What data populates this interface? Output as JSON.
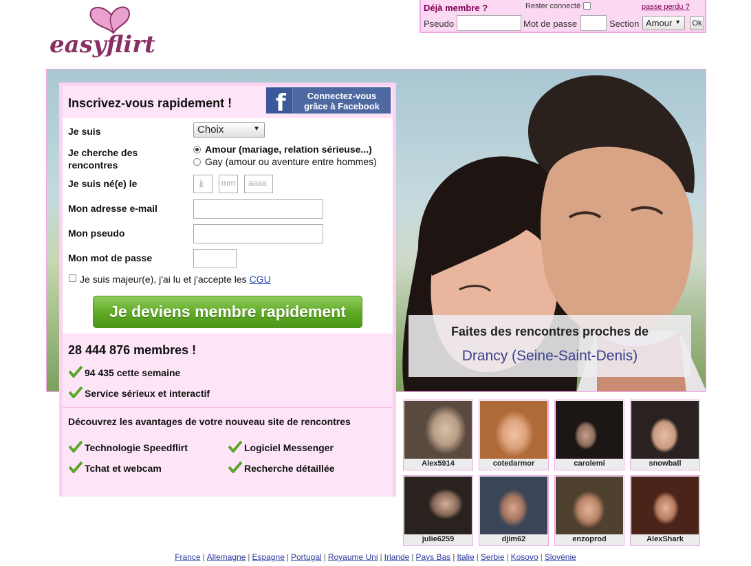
{
  "brand": {
    "logo_text": "easyflirt"
  },
  "login": {
    "title": "Déjà membre ?",
    "remember_label": "Rester connecté",
    "lost_password": "passe perdu ?",
    "pseudo_label": "Pseudo",
    "password_label": "Mot de passe",
    "section_label": "Section",
    "section_value": "Amour",
    "ok_label": "Ok"
  },
  "signup": {
    "title": "Inscrivez-vous rapidement !",
    "facebook_line1": "Connectez-vous",
    "facebook_line2": "grâce à Facebook",
    "gender_label": "Je suis",
    "gender_value": "Choix",
    "looking_label": "Je cherche des rencontres",
    "option_love": "Amour (mariage, relation sérieuse...)",
    "option_gay": "Gay (amour ou aventure entre hommes)",
    "birth_label": "Je suis né(e) le",
    "day_placeholder": "jj",
    "month_placeholder": "mm",
    "year_placeholder": "aaaa",
    "email_label": "Mon adresse e-mail",
    "pseudo_label": "Mon pseudo",
    "password_label": "Mon mot de passe",
    "agree_text": "Je suis majeur(e), j'ai lu et j'accepte les",
    "agree_link": "CGU",
    "submit_label": "Je deviens membre rapidement"
  },
  "stats": {
    "members": "28 444 876 membres !",
    "this_week": "94 435 cette semaine",
    "service": "Service sérieux et interactif",
    "advantages_title": "Découvrez les avantages de votre nouveau site de rencontres",
    "advantages": [
      "Technologie Speedflirt",
      "Logiciel Messenger",
      "Tchat et webcam",
      "Recherche détaillée"
    ]
  },
  "city": {
    "line1": "Faites des rencontres proches de",
    "line2": "Drancy (Seine-Saint-Denis)"
  },
  "profiles": [
    {
      "name": "Alex5914"
    },
    {
      "name": "cotedarmor"
    },
    {
      "name": "carolemi"
    },
    {
      "name": "snowball"
    },
    {
      "name": "julie6259"
    },
    {
      "name": "djim62"
    },
    {
      "name": "enzoprod"
    },
    {
      "name": "AlexShark"
    }
  ],
  "countries": [
    "France",
    "Allemagne",
    "Espagne",
    "Portugal",
    "Royaume Uni",
    "Irlande",
    "Pays Bas",
    "Italie",
    "Serbie",
    "Kosovo",
    "Slovénie"
  ],
  "colors": {
    "accent_pink": "#f0a6e4",
    "panel_pink": "#fde4f6",
    "brand_purple": "#800054",
    "cta_green": "#5ea825",
    "facebook_blue": "#3b5998",
    "city_blue": "#3a3f8f"
  }
}
